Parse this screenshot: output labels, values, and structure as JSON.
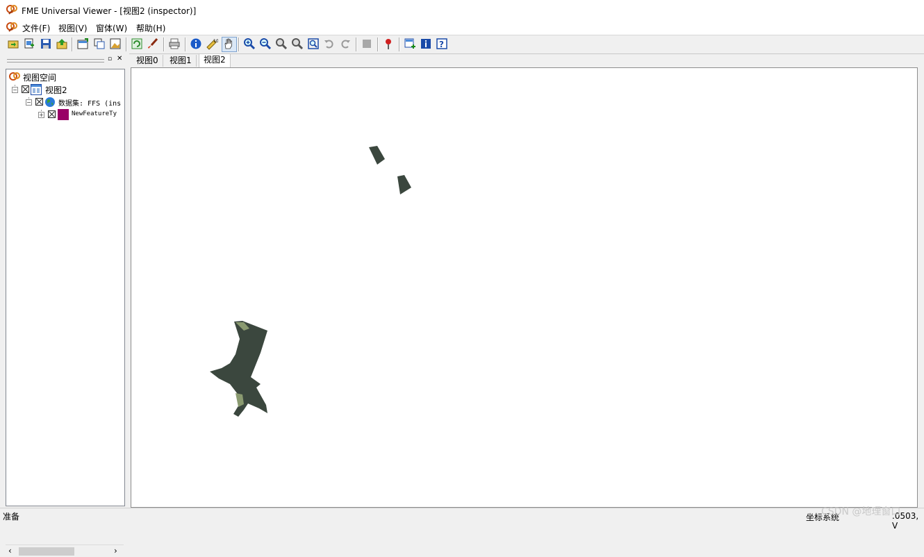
{
  "window": {
    "title": "FME Universal Viewer - [视图2 (inspector)]"
  },
  "menu": {
    "items": [
      "文件(F)",
      "视图(V)",
      "窗体(W)",
      "帮助(H)"
    ]
  },
  "toolbar": {
    "buttons": [
      "open-icon",
      "add-dataset-icon",
      "save-icon",
      "export-icon",
      "new-view-icon",
      "copy-view-icon",
      "view-image-icon",
      "refresh-icon",
      "brush-icon",
      "print-icon",
      "info-icon",
      "measure-icon",
      "pan-icon",
      "zoom-in-icon",
      "zoom-out-icon",
      "zoom-icon",
      "zoom-prev-icon",
      "zoom-extent-icon",
      "undo-icon",
      "redo-icon",
      "stop-icon",
      "pin-icon",
      "add-layer-icon",
      "properties-icon",
      "help-icon"
    ]
  },
  "tree": {
    "root_label": "视图空间",
    "view_label": "视图2",
    "dataset_label": "数据集: FFS (ins",
    "feature_label": "NewFeatureTy"
  },
  "tabs": [
    "视图0",
    "视图1",
    "视图2"
  ],
  "selected_tab": "视图2",
  "status": {
    "text": "准备",
    "coord_label": "坐标系统",
    "coord_value": ".0503, V",
    "watermark": "CSDN @地理窗口"
  },
  "colors": {
    "feature_fill": "#3b473e",
    "feature_swatch": "#990066"
  }
}
